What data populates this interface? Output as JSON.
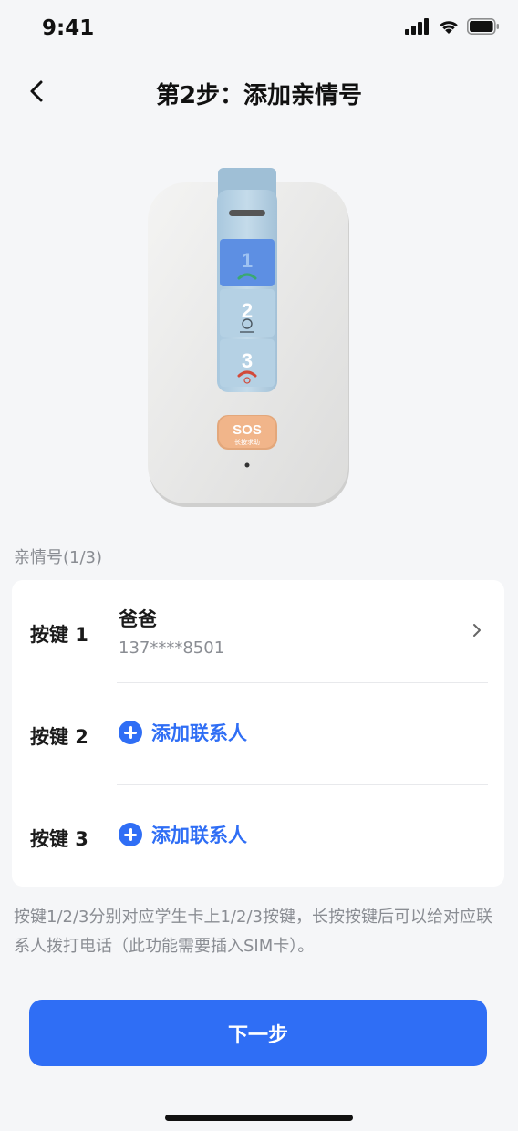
{
  "status": {
    "time": "9:41",
    "icons": [
      "cellular-signal-icon",
      "wifi-icon",
      "battery-icon"
    ]
  },
  "nav": {
    "back_icon": "chevron-left-icon",
    "title": "第2步：添加亲情号"
  },
  "device": {
    "keys": [
      "1",
      "2",
      "3"
    ],
    "sos_label": "SOS",
    "sos_sub": "长按求助"
  },
  "section": {
    "label": "亲情号(1/3)"
  },
  "rows": [
    {
      "label": "按键 1",
      "contact_name": "爸爸",
      "contact_phone": "137****8501"
    },
    {
      "label": "按键 2",
      "add_text": "添加联系人"
    },
    {
      "label": "按键 3",
      "add_text": "添加联系人"
    }
  ],
  "tip": "按键1/2/3分别对应学生卡上1/2/3按键，长按按键后可以给对应联系人拨打电话（此功能需要插入SIM卡）。",
  "next_button": "下一步",
  "colors": {
    "accent": "#2f6ef5",
    "background": "#f5f6f8",
    "card": "#ffffff",
    "muted_text": "#8a8d93"
  }
}
